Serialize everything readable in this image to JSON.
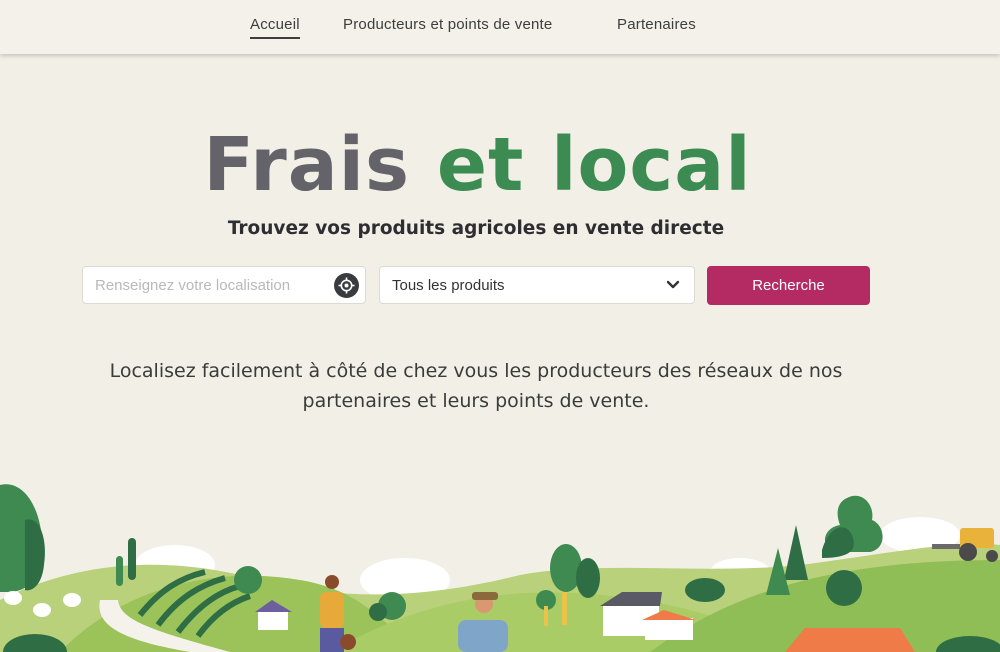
{
  "nav": {
    "items": [
      {
        "label": "Accueil",
        "active": true
      },
      {
        "label": "Producteurs et points de vente",
        "active": false
      },
      {
        "label": "Partenaires",
        "active": false
      }
    ]
  },
  "hero": {
    "title_part1": "Frais",
    "title_part2": "et local",
    "subtitle": "Trouvez vos produits agricoles en vente directe"
  },
  "search": {
    "location_placeholder": "Renseignez votre localisation",
    "location_value": "",
    "product_selected": "Tous les produits",
    "button_label": "Recherche"
  },
  "description": {
    "line1": "Localisez facilement à côté de chez vous les producteurs des réseaux de nos",
    "line2": "partenaires et leurs points de vente."
  },
  "icons": {
    "geolocate": "crosshair-target-icon",
    "dropdown": "chevron-down-icon"
  },
  "colors": {
    "background": "#f2f0e6",
    "title_gray": "#65636a",
    "title_green": "#3c8b52",
    "button_primary": "#b42a62"
  }
}
